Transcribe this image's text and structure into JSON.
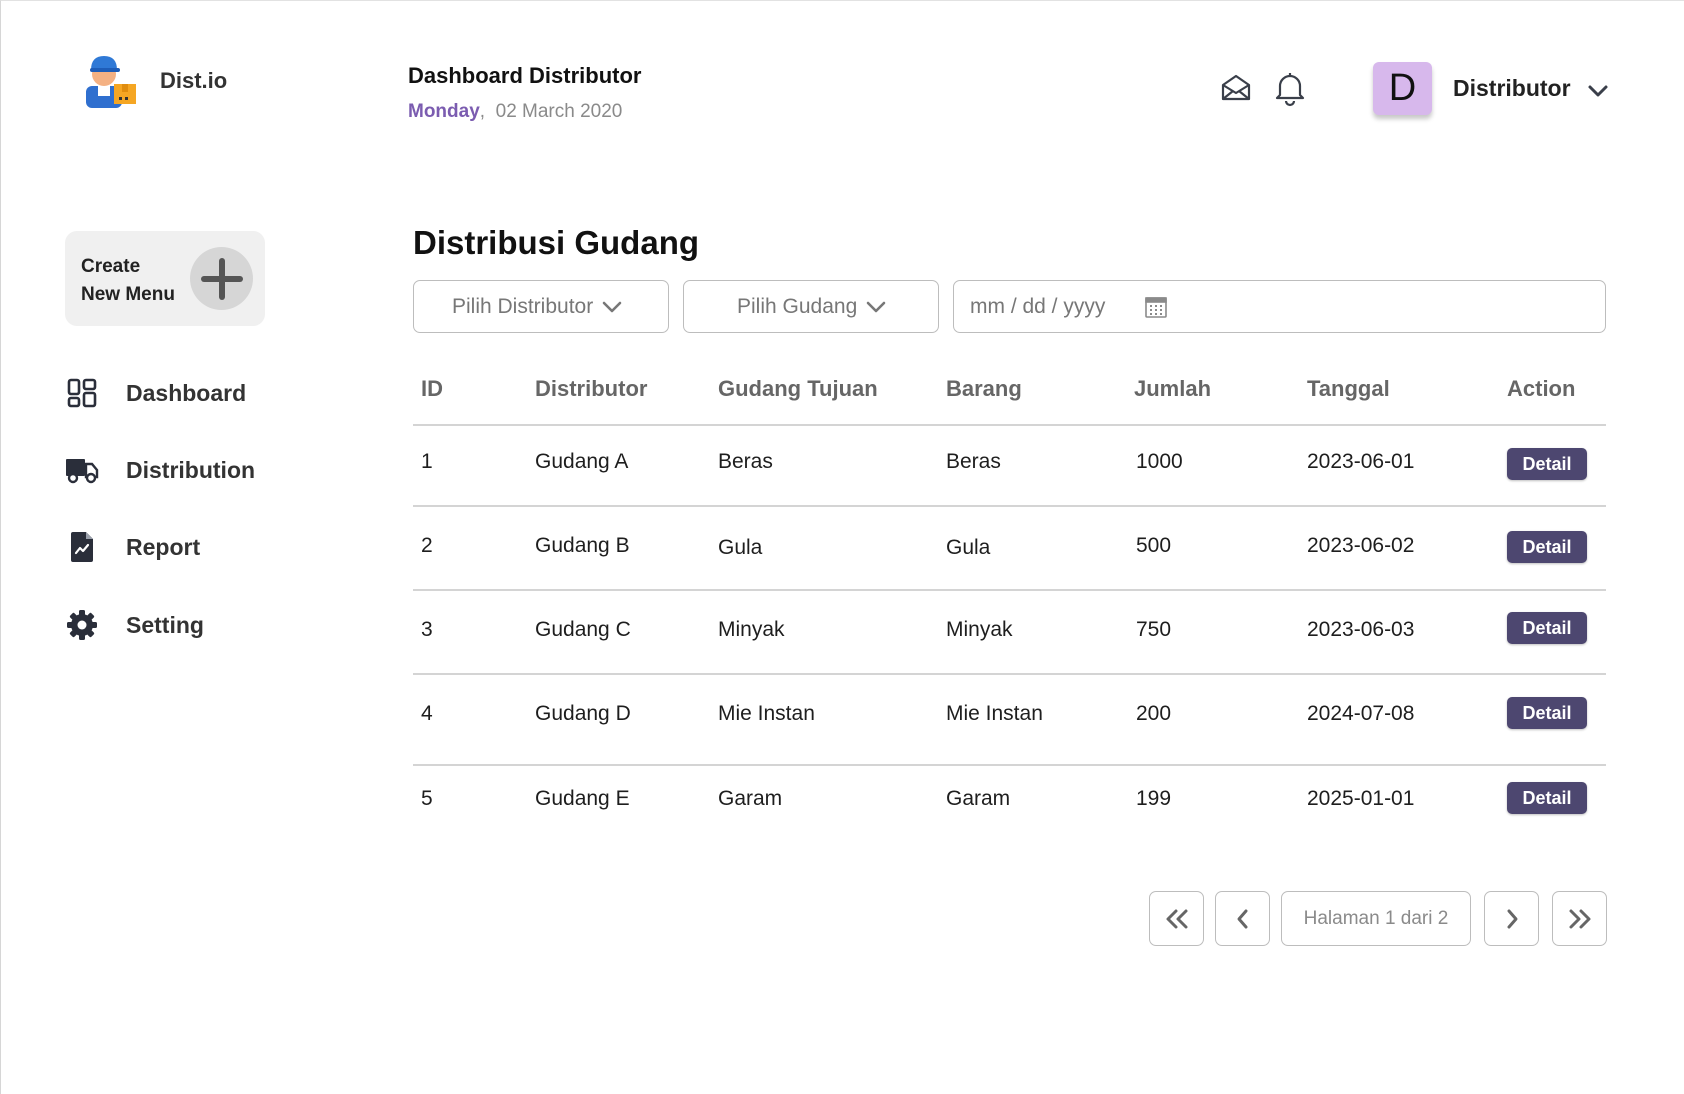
{
  "app": {
    "logo_text": "Dist.io"
  },
  "header": {
    "title": "Dashboard Distributor",
    "day": "Monday",
    "separator": ",",
    "date": "02 March 2020",
    "icons": [
      "mail-icon",
      "bell-icon",
      "chevron-down-icon"
    ],
    "avatar_letter": "D",
    "avatar_color": "#d7b8ec",
    "user_name": "Distributor"
  },
  "sidebar": {
    "create_line1": "Create",
    "create_line2": "New Menu",
    "items": [
      {
        "label": "Dashboard",
        "icon": "grid-icon"
      },
      {
        "label": "Distribution",
        "icon": "truck-icon"
      },
      {
        "label": "Report",
        "icon": "report-icon"
      },
      {
        "label": "Setting",
        "icon": "gear-icon"
      }
    ]
  },
  "main": {
    "title": "Distribusi Gudang",
    "filters": {
      "distributor": "Pilih Distributor",
      "gudang": "Pilih Gudang",
      "date_placeholder": "mm / dd / yyyy"
    },
    "table": {
      "columns": [
        "ID",
        "Distributor",
        "Gudang Tujuan",
        "Barang",
        "Jumlah",
        "Tanggal",
        "Action"
      ],
      "rows": [
        {
          "id": "1",
          "distributor": "Gudang A",
          "tujuan": "Beras",
          "barang": "Beras",
          "jumlah": "1000",
          "tanggal": "2023-06-01",
          "action": "Detail"
        },
        {
          "id": "2",
          "distributor": "Gudang B",
          "tujuan": "Gula",
          "barang": "Gula",
          "jumlah": "500",
          "tanggal": "2023-06-02",
          "action": "Detail"
        },
        {
          "id": "3",
          "distributor": "Gudang C",
          "tujuan": "Minyak",
          "barang": "Minyak",
          "jumlah": "750",
          "tanggal": "2023-06-03",
          "action": "Detail"
        },
        {
          "id": "4",
          "distributor": "Gudang D",
          "tujuan": "Mie Instan",
          "barang": "Mie Instan",
          "jumlah": "200",
          "tanggal": "2024-07-08",
          "action": "Detail"
        },
        {
          "id": "5",
          "distributor": "Gudang E",
          "tujuan": "Garam",
          "barang": "Garam",
          "jumlah": "199",
          "tanggal": "2025-01-01",
          "action": "Detail"
        }
      ]
    },
    "pagination": {
      "info": "Halaman 1 dari 2",
      "icons": [
        "double-chevron-left-icon",
        "chevron-left-icon",
        "chevron-right-icon",
        "double-chevron-right-icon"
      ]
    },
    "colors": {
      "detail_button": "#4d4770",
      "accent_day": "#7b5cb0"
    }
  }
}
